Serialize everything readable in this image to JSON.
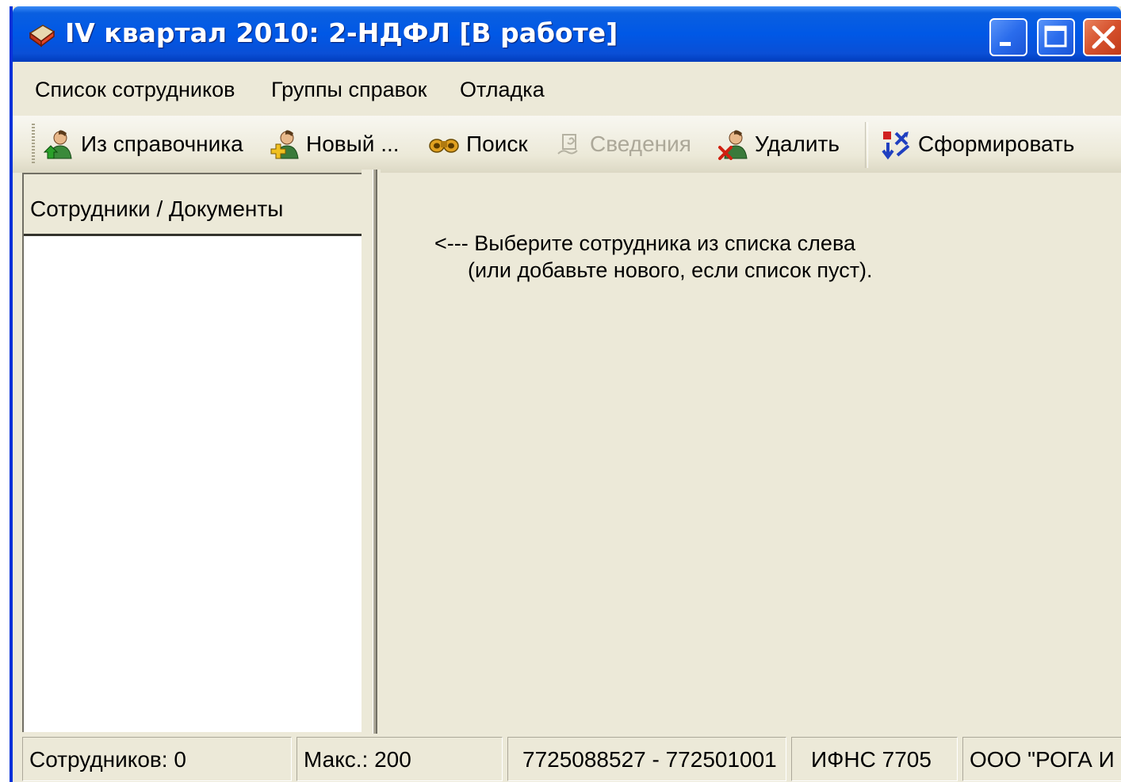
{
  "window": {
    "title": "IV квартал 2010: 2-НДФЛ [В работе]"
  },
  "menu": {
    "items": [
      {
        "label": "Список сотрудников"
      },
      {
        "label": "Группы справок"
      },
      {
        "label": "Отладка"
      }
    ]
  },
  "toolbar": {
    "from_directory": "Из справочника",
    "new": "Новый ...",
    "search": "Поиск",
    "info": "Сведения",
    "delete": "Удалить",
    "generate": "Сформировать"
  },
  "left_pane": {
    "header": "Сотрудники / Документы"
  },
  "right_pane": {
    "hint_line1": "<--- Выберите сотрудника из списка слева",
    "hint_line2": "(или добавьте нового, если список пуст)."
  },
  "statusbar": {
    "employees": "Сотрудников: 0",
    "max": "Макс.: 200",
    "inn_kpp": "7725088527 - 772501001",
    "ifns": "ИФНС 7705",
    "org": "ООО \"РОГА И"
  },
  "colors": {
    "titlebar": "#0058e6",
    "window_bg": "#ece9d8",
    "close_button": "#d5502c",
    "disabled_text": "#aca899"
  }
}
